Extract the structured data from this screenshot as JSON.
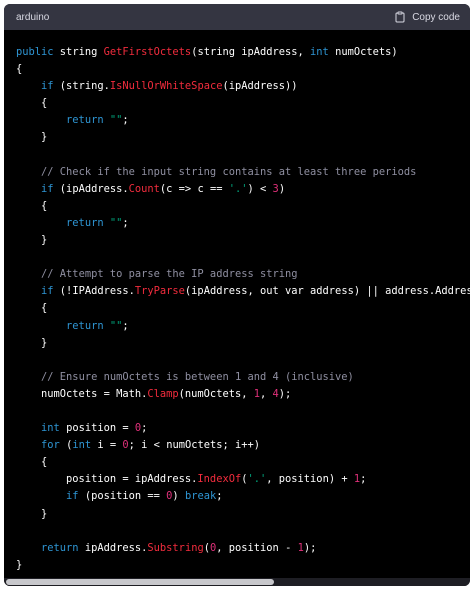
{
  "header": {
    "language": "arduino",
    "copy_label": "Copy code"
  },
  "code": {
    "lines": [
      [
        {
          "t": "public",
          "c": "kw"
        },
        {
          "t": " string "
        },
        {
          "t": "GetFirstOctets",
          "c": "fn"
        },
        {
          "t": "(string ipAddress, "
        },
        {
          "t": "int",
          "c": "kw"
        },
        {
          "t": " numOctets)"
        }
      ],
      [
        {
          "t": "{"
        }
      ],
      [
        {
          "t": "    "
        },
        {
          "t": "if",
          "c": "kw"
        },
        {
          "t": " (string."
        },
        {
          "t": "IsNullOrWhiteSpace",
          "c": "fn"
        },
        {
          "t": "(ipAddress))"
        }
      ],
      [
        {
          "t": "    {"
        }
      ],
      [
        {
          "t": "        "
        },
        {
          "t": "return",
          "c": "kw"
        },
        {
          "t": " "
        },
        {
          "t": "\"\"",
          "c": "str"
        },
        {
          "t": ";"
        }
      ],
      [
        {
          "t": "    }"
        }
      ],
      [],
      [
        {
          "t": "    "
        },
        {
          "t": "// Check if the input string contains at least three periods",
          "c": "cm"
        }
      ],
      [
        {
          "t": "    "
        },
        {
          "t": "if",
          "c": "kw"
        },
        {
          "t": " (ipAddress."
        },
        {
          "t": "Count",
          "c": "fn"
        },
        {
          "t": "(c => c == "
        },
        {
          "t": "'.'",
          "c": "str"
        },
        {
          "t": ") < "
        },
        {
          "t": "3",
          "c": "num"
        },
        {
          "t": ")"
        }
      ],
      [
        {
          "t": "    {"
        }
      ],
      [
        {
          "t": "        "
        },
        {
          "t": "return",
          "c": "kw"
        },
        {
          "t": " "
        },
        {
          "t": "\"\"",
          "c": "str"
        },
        {
          "t": ";"
        }
      ],
      [
        {
          "t": "    }"
        }
      ],
      [],
      [
        {
          "t": "    "
        },
        {
          "t": "// Attempt to parse the IP address string",
          "c": "cm"
        }
      ],
      [
        {
          "t": "    "
        },
        {
          "t": "if",
          "c": "kw"
        },
        {
          "t": " (!IPAddress."
        },
        {
          "t": "TryParse",
          "c": "fn"
        },
        {
          "t": "(ipAddress, out var address) || address.AddressFamily"
        }
      ],
      [
        {
          "t": "    {"
        }
      ],
      [
        {
          "t": "        "
        },
        {
          "t": "return",
          "c": "kw"
        },
        {
          "t": " "
        },
        {
          "t": "\"\"",
          "c": "str"
        },
        {
          "t": ";"
        }
      ],
      [
        {
          "t": "    }"
        }
      ],
      [],
      [
        {
          "t": "    "
        },
        {
          "t": "// Ensure numOctets is between 1 and 4 (inclusive)",
          "c": "cm"
        }
      ],
      [
        {
          "t": "    numOctets = Math."
        },
        {
          "t": "Clamp",
          "c": "fn"
        },
        {
          "t": "(numOctets, "
        },
        {
          "t": "1",
          "c": "num"
        },
        {
          "t": ", "
        },
        {
          "t": "4",
          "c": "num"
        },
        {
          "t": ");"
        }
      ],
      [],
      [
        {
          "t": "    "
        },
        {
          "t": "int",
          "c": "kw"
        },
        {
          "t": " position = "
        },
        {
          "t": "0",
          "c": "num"
        },
        {
          "t": ";"
        }
      ],
      [
        {
          "t": "    "
        },
        {
          "t": "for",
          "c": "kw"
        },
        {
          "t": " ("
        },
        {
          "t": "int",
          "c": "kw"
        },
        {
          "t": " i = "
        },
        {
          "t": "0",
          "c": "num"
        },
        {
          "t": "; i < numOctets; i++)"
        }
      ],
      [
        {
          "t": "    {"
        }
      ],
      [
        {
          "t": "        position = ipAddress."
        },
        {
          "t": "IndexOf",
          "c": "fn"
        },
        {
          "t": "("
        },
        {
          "t": "'.'",
          "c": "str"
        },
        {
          "t": ", position) + "
        },
        {
          "t": "1",
          "c": "num"
        },
        {
          "t": ";"
        }
      ],
      [
        {
          "t": "        "
        },
        {
          "t": "if",
          "c": "kw"
        },
        {
          "t": " (position == "
        },
        {
          "t": "0",
          "c": "num"
        },
        {
          "t": ") "
        },
        {
          "t": "break",
          "c": "kw"
        },
        {
          "t": ";"
        }
      ],
      [
        {
          "t": "    }"
        }
      ],
      [],
      [
        {
          "t": "    "
        },
        {
          "t": "return",
          "c": "kw"
        },
        {
          "t": " ipAddress."
        },
        {
          "t": "Substring",
          "c": "fn"
        },
        {
          "t": "("
        },
        {
          "t": "0",
          "c": "num"
        },
        {
          "t": ", position - "
        },
        {
          "t": "1",
          "c": "num"
        },
        {
          "t": ");"
        }
      ],
      [
        {
          "t": "}"
        }
      ]
    ]
  },
  "colors": {
    "keyword": "#2e95d3",
    "function": "#f22c3d",
    "string": "#00a67d",
    "number": "#df3079",
    "comment": "#8f8fa1",
    "plain": "#ffffff",
    "header_bg": "#343541",
    "code_bg": "#000000"
  },
  "icons": {
    "copy": "clipboard-icon"
  },
  "scroll": {
    "horizontal_visible_fraction": 0.58
  }
}
